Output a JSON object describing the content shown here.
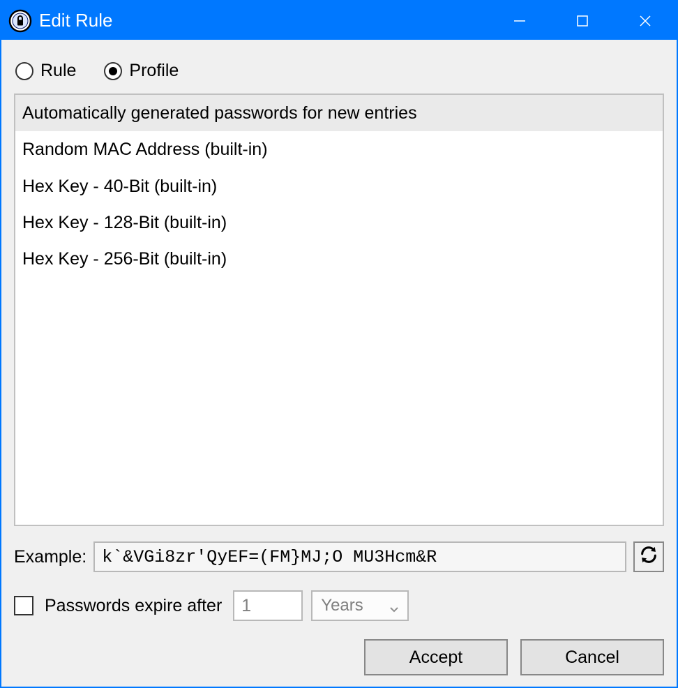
{
  "window": {
    "title": "Edit Rule"
  },
  "radios": {
    "rule": {
      "label": "Rule",
      "selected": false
    },
    "profile": {
      "label": "Profile",
      "selected": true
    }
  },
  "profiles": [
    {
      "label": "Automatically generated passwords for new entries",
      "selected": true
    },
    {
      "label": "Random MAC Address (built-in)",
      "selected": false
    },
    {
      "label": "Hex Key - 40-Bit (built-in)",
      "selected": false
    },
    {
      "label": "Hex Key - 128-Bit (built-in)",
      "selected": false
    },
    {
      "label": "Hex Key - 256-Bit (built-in)",
      "selected": false
    }
  ],
  "example": {
    "label": "Example:",
    "value": "k`&VGi8zr'QyEF=(FM}MJ;O MU3Hcm&R"
  },
  "expire": {
    "checkbox_label": "Passwords expire after",
    "checked": false,
    "count": "1",
    "unit": "Years"
  },
  "buttons": {
    "accept": "Accept",
    "cancel": "Cancel"
  }
}
